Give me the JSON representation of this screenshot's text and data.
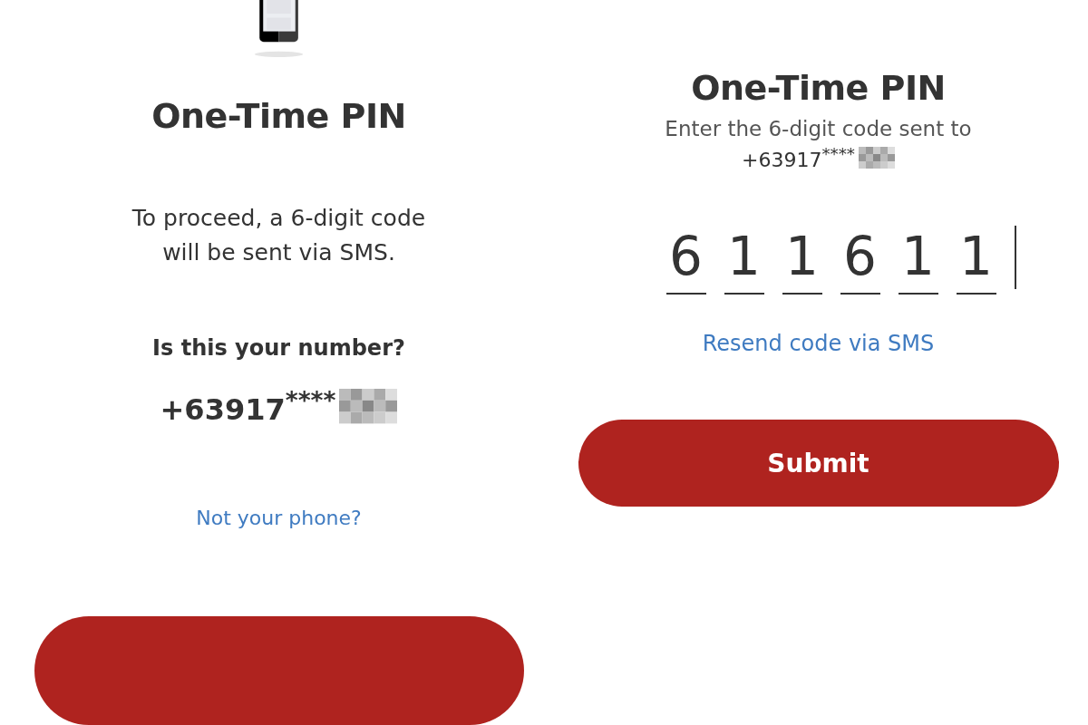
{
  "left_screen": {
    "title": "One-Time PIN",
    "message": "To proceed, a 6-digit code will be sent via SMS.",
    "question": "Is this your number?",
    "phone_number": "+63917$^{****}$",
    "link": "Not your phone?"
  },
  "right_screen": {
    "title": "One-Time PIN",
    "subtitle": "Enter the 6-digit code sent to",
    "phone_number": "+63917$^{****}$",
    "code_digits": [
      "6",
      "1",
      "1",
      "6",
      "1",
      "1"
    ],
    "link": "Resend code via SMS",
    "button": "Submit"
  }
}
